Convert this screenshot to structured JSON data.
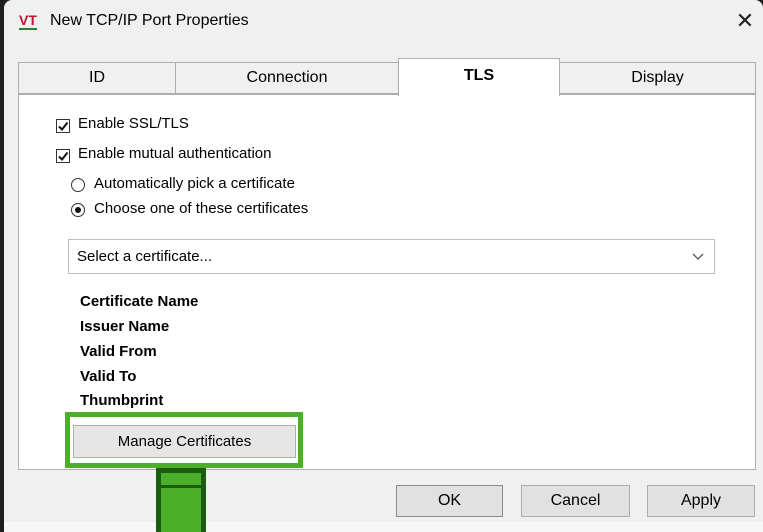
{
  "window": {
    "title": "New TCP/IP Port Properties",
    "logo_text": "VT",
    "close_glyph": "✕"
  },
  "tabs": [
    {
      "label": "ID",
      "active": false
    },
    {
      "label": "Connection",
      "active": false
    },
    {
      "label": "TLS",
      "active": true
    },
    {
      "label": "Display",
      "active": false
    }
  ],
  "tls": {
    "enable_ssl_label": "Enable SSL/TLS",
    "enable_ssl_checked": true,
    "mutual_auth_label": "Enable mutual authentication",
    "mutual_auth_checked": true,
    "auto_pick_label": "Automatically pick a certificate",
    "choose_label": "Choose one of these certificates",
    "selected_option": "choose",
    "select_placeholder": "Select a certificate...",
    "info_labels": [
      "Certificate Name",
      "Issuer Name",
      "Valid From",
      "Valid To",
      "Thumbprint"
    ],
    "manage_button": "Manage Certificates"
  },
  "footer": {
    "ok": "OK",
    "cancel": "Cancel",
    "apply": "Apply"
  },
  "colors": {
    "highlight": "#4caf2a",
    "highlight_dark": "#1c5c10"
  }
}
